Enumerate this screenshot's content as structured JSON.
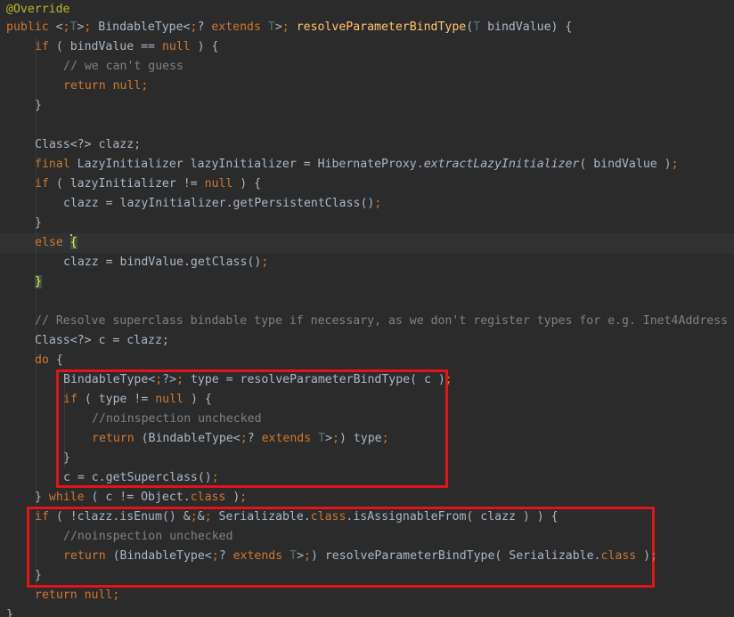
{
  "editor": {
    "lines": [
      "@Override",
      "public <T> BindableType<? extends T> resolveParameterBindType(T bindValue) {",
      "if ( bindValue == null ) {",
      "// we can't guess",
      "return null;",
      "}",
      "",
      "Class<?> clazz;",
      "final LazyInitializer lazyInitializer = HibernateProxy.extractLazyInitializer( bindValue );",
      "if ( lazyInitializer != null ) {",
      "clazz = lazyInitializer.getPersistentClass();",
      "}",
      "else {",
      "clazz = bindValue.getClass();",
      "}",
      "",
      "// Resolve superclass bindable type if necessary, as we don't register types for e.g. Inet4Address",
      "Class<?> c = clazz;",
      "do {",
      "BindableType<?> type = resolveParameterBindType( c );",
      "if ( type != null ) {",
      "//noinspection unchecked",
      "return (BindableType<? extends T>) type;",
      "}",
      "c = c.getSuperclass();",
      "} while ( c != Object.class );",
      "if ( !clazz.isEnum() && Serializable.class.isAssignableFrom( clazz ) ) {",
      "//noinspection unchecked",
      "return (BindableType<? extends T>) resolveParameterBindType( Serializable.class );",
      "}",
      "return null;",
      "}"
    ],
    "highlight_colors": {
      "keyword": "#cc7832",
      "annotation": "#bbb529",
      "type_param": "#507874",
      "method_decl": "#ffc66d",
      "comment": "#808080",
      "static_member": "#9876aa",
      "text": "#a9b7c6",
      "background": "#2b2b2b",
      "annotation_box": "#e0141c"
    }
  }
}
